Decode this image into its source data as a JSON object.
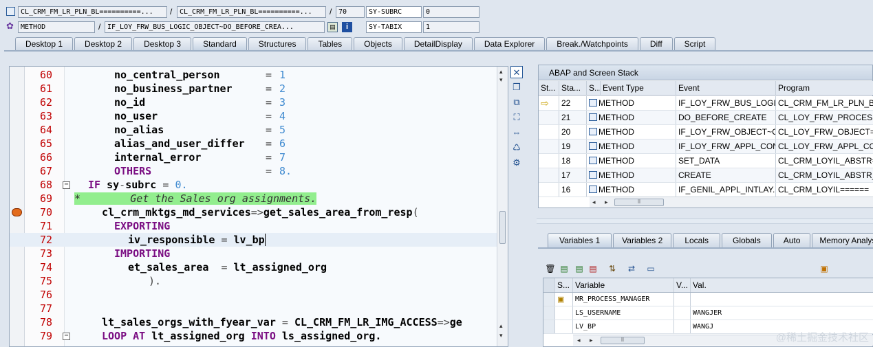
{
  "top_bar": {
    "program1": "CL_CRM_FM_LR_PLN_BL==========...",
    "program2": "CL_CRM_FM_LR_PLN_BL==========...",
    "line_no": "70",
    "sy_subrc_label": "SY-SUBRC",
    "sy_subrc_value": "0",
    "event_type": "METHOD",
    "event": "IF_LOY_FRW_BUS_LOGIC_OBJECT~DO_BEFORE_CREA...",
    "sy_tabix_label": "SY-TABIX",
    "sy_tabix_value": "1",
    "separator": "/"
  },
  "tabs": [
    "Desktop 1",
    "Desktop 2",
    "Desktop 3",
    "Standard",
    "Structures",
    "Tables",
    "Objects",
    "DetailDisplay",
    "Data Explorer",
    "Break./Watchpoints",
    "Diff",
    "Script"
  ],
  "active_tab": "Standard",
  "code": {
    "lines": [
      {
        "n": "60"
      },
      {
        "n": "61"
      },
      {
        "n": "62"
      },
      {
        "n": "63"
      },
      {
        "n": "64"
      },
      {
        "n": "65"
      },
      {
        "n": "66"
      },
      {
        "n": "67"
      },
      {
        "n": "68"
      },
      {
        "n": "69"
      },
      {
        "n": "70"
      },
      {
        "n": "71"
      },
      {
        "n": "72"
      },
      {
        "n": "73"
      },
      {
        "n": "74"
      },
      {
        "n": "75"
      },
      {
        "n": "76"
      },
      {
        "n": "77"
      },
      {
        "n": "78"
      },
      {
        "n": "79"
      }
    ],
    "t": {
      "l60a": "no_central_person",
      "l60b": "=",
      "l60c": "1",
      "l61a": "no_business_partner",
      "l61b": "=",
      "l61c": "2",
      "l62a": "no_id",
      "l62b": "=",
      "l62c": "3",
      "l63a": "no_user",
      "l63b": "=",
      "l63c": "4",
      "l64a": "no_alias",
      "l64b": "=",
      "l64c": "5",
      "l65a": "alias_and_user_differ",
      "l65b": "=",
      "l65c": "6",
      "l66a": "internal_error",
      "l66b": "=",
      "l66c": "7",
      "l67a": "OTHERS",
      "l67b": "=",
      "l67c": "8",
      "dot": ".",
      "l68a": "IF",
      "l68b": "sy",
      "l68c": "-",
      "l68d": "subrc",
      "l68e": "=",
      "l68f": "0",
      "l69": "*        Get the Sales org assignments.",
      "l70a": "cl_crm_mktgs_md_services",
      "l70b": "=>",
      "l70c": "get_sales_area_from_resp",
      "l70d": "(",
      "l71": "EXPORTING",
      "l72a": "iv_responsible",
      "l72b": "=",
      "l72c": "lv_bp",
      "l73": "IMPORTING",
      "l74a": "et_sales_area",
      "l74b": "=",
      "l74c": "lt_assigned_org",
      "l75": ").",
      "l78a": "lt_sales_orgs_with_fyear_var",
      "l78b": "=",
      "l78c": "CL_CRM_FM_LR_IMG_ACCESS",
      "l78d": "=>",
      "l78e": "ge",
      "l79a": "LOOP AT",
      "l79b": "lt_assigned_org",
      "l79c": "INTO",
      "l79d": "ls_assigned_org"
    }
  },
  "stack": {
    "title": "ABAP and Screen Stack",
    "columns": [
      "St...",
      "Sta...",
      "S...",
      "Event Type",
      "Event",
      "Program"
    ],
    "rows": [
      {
        "level": "22",
        "type": "METHOD",
        "event": "IF_LOY_FRW_BUS_LOGI...",
        "program": "CL_CRM_FM_LR_PLN_BL..."
      },
      {
        "level": "21",
        "type": "METHOD",
        "event": "DO_BEFORE_CREATE",
        "program": "CL_LOY_FRW_PROCESS..."
      },
      {
        "level": "20",
        "type": "METHOD",
        "event": "IF_LOY_FRW_OBJECT~C...",
        "program": "CL_LOY_FRW_OBJECT=..."
      },
      {
        "level": "19",
        "type": "METHOD",
        "event": "IF_LOY_FRW_APPL_CON...",
        "program": "CL_LOY_FRW_APPL_CO..."
      },
      {
        "level": "18",
        "type": "METHOD",
        "event": "SET_DATA",
        "program": "CL_CRM_LOYIL_ABSTR=..."
      },
      {
        "level": "17",
        "type": "METHOD",
        "event": "CREATE",
        "program": "CL_CRM_LOYIL_ABSTR_..."
      },
      {
        "level": "16",
        "type": "METHOD",
        "event": "IF_GENIL_APPL_INTLAY...",
        "program": "CL_CRM_LOYIL======"
      }
    ]
  },
  "var_tabs": [
    "Variables 1",
    "Variables 2",
    "Locals",
    "Globals",
    "Auto",
    "Memory Analysis"
  ],
  "vars": {
    "columns": [
      "S...",
      "Variable",
      "V...",
      "Val."
    ],
    "rows": [
      {
        "name": "MR_PROCESS_MANAGER",
        "value": ""
      },
      {
        "name": "LS_USERNAME",
        "value": "WANGJER"
      },
      {
        "name": "LV_BP",
        "value": "WANGJ"
      }
    ]
  },
  "scroll": {
    "left": "◂",
    "right": "▸",
    "up": "▴",
    "down": "▾",
    "grip": "⠿"
  },
  "watermark": "@稀土掘金技术社区"
}
